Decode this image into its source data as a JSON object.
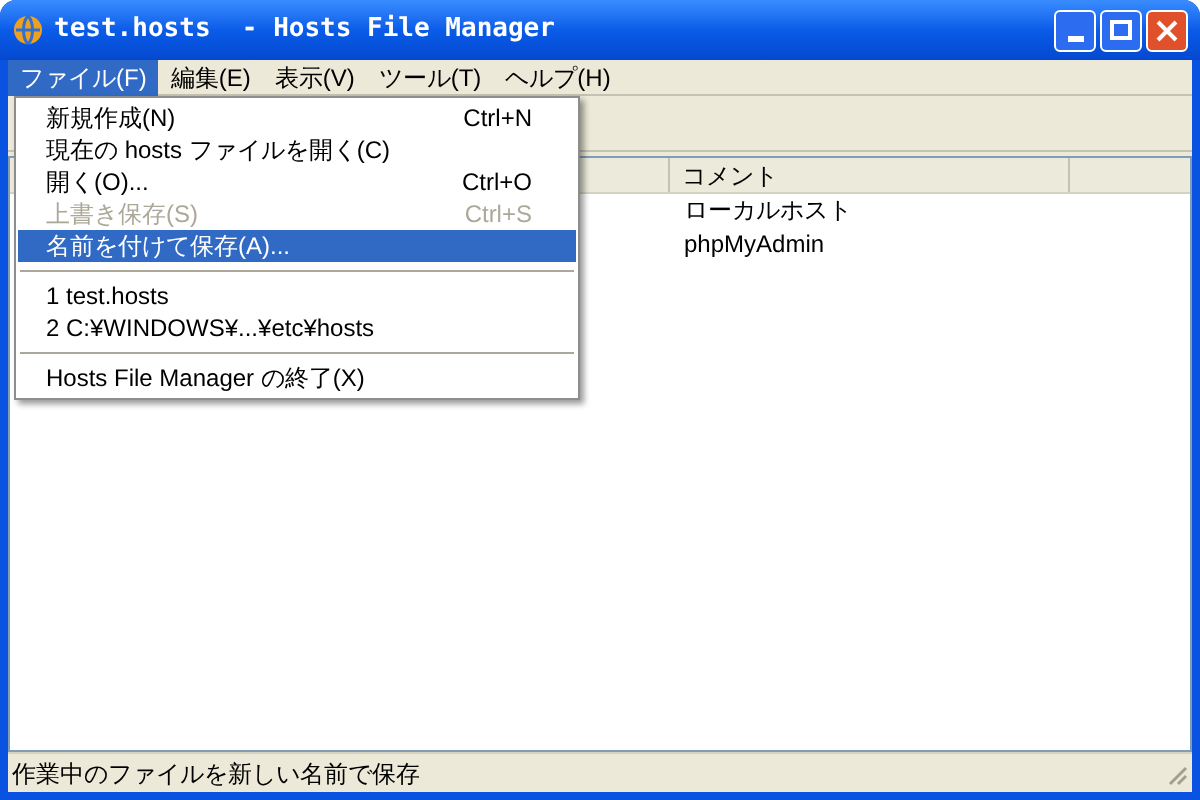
{
  "window": {
    "title": "test.hosts  - Hosts File Manager"
  },
  "menu_bar": [
    {
      "label": "ファイル(F)",
      "selected": true
    },
    {
      "label": "編集(E)",
      "selected": false
    },
    {
      "label": "表示(V)",
      "selected": false
    },
    {
      "label": "ツール(T)",
      "selected": false
    },
    {
      "label": "ヘルプ(H)",
      "selected": false
    }
  ],
  "file_menu": [
    {
      "kind": "item",
      "label": "新規作成(N)",
      "shortcut": "Ctrl+N",
      "disabled": false,
      "selected": false
    },
    {
      "kind": "item",
      "label": "現在の hosts ファイルを開く(C)",
      "disabled": false,
      "selected": false
    },
    {
      "kind": "item",
      "label": "開く(O)...",
      "shortcut": "Ctrl+O",
      "disabled": false,
      "selected": false
    },
    {
      "kind": "item",
      "label": "上書き保存(S)",
      "shortcut": "Ctrl+S",
      "disabled": true,
      "selected": false
    },
    {
      "kind": "item",
      "label": "名前を付けて保存(A)...",
      "disabled": false,
      "selected": true
    },
    {
      "kind": "separator"
    },
    {
      "kind": "item",
      "label": "1 test.hosts",
      "disabled": false,
      "selected": false
    },
    {
      "kind": "item",
      "label": "2 C:¥WINDOWS¥...¥etc¥hosts",
      "disabled": false,
      "selected": false
    },
    {
      "kind": "separator"
    },
    {
      "kind": "item",
      "label": "Hosts File Manager の終了(X)",
      "disabled": false,
      "selected": false
    }
  ],
  "table": {
    "columns": [
      "コメント"
    ],
    "rows": [
      {
        "comment": "ローカルホスト"
      },
      {
        "comment": "phpMyAdmin"
      }
    ]
  },
  "status_bar": {
    "text": "作業中のファイルを新しい名前で保存"
  }
}
